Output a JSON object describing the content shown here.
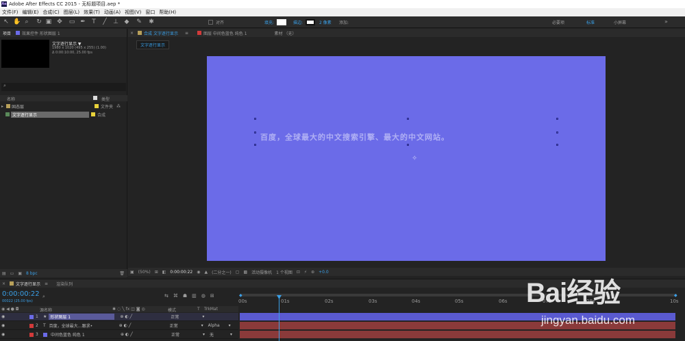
{
  "app": {
    "title": "Adobe After Effects CC 2015 - 无标题项目.aep *",
    "logo": "Ae"
  },
  "menu": [
    "文件(F)",
    "编辑(E)",
    "合成(C)",
    "图层(L)",
    "效果(T)",
    "动画(A)",
    "视图(V)",
    "窗口",
    "帮助(H)"
  ],
  "toolbar": {
    "align_label": "对齐",
    "fill_label": "填充:",
    "stroke_label": "描边:",
    "stroke_width": "2 像素",
    "add_label": "添加:",
    "workspaces": [
      "必要项",
      "标准",
      "小屏幕"
    ]
  },
  "project": {
    "tab": "项目",
    "effects_tab": "效果控件 形状图层 1",
    "comp_name": "文字逐行显示 ▼",
    "comp_size": "1980 x 1020 (495 x 255) (1.00)",
    "comp_duration": "Δ 0:00:10:00, 25.00 fps",
    "col_name": "名称",
    "col_type": "类型",
    "items": [
      {
        "name": "固态层",
        "type": "文件夹",
        "color": "#e8d23a"
      },
      {
        "name": "文字逐行显示",
        "type": "合成",
        "color": "#e8d23a"
      }
    ],
    "bpc": "8 bpc"
  },
  "viewer": {
    "tab_comp": "合成 文字逐行显示",
    "tab_layer": "图层 中间色蓝色 纯色 1",
    "tab_footage": "素材 （无）",
    "breadcrumb": "文字逐行显示",
    "canvas_text": "百度，全球最大的中文搜索引擎、最大的中文网站。",
    "bg": "#6b6be8",
    "zoom": "(50%)",
    "time": "0:00:00:22",
    "resolution": "(二分之一)",
    "camera": "活动摄像机",
    "views": "1 个视图",
    "exposure": "+0.0"
  },
  "timeline": {
    "tab": "文字逐行显示",
    "queue_tab": "渲染队列",
    "timecode": "0:00:00:22",
    "fps": "00022 (25.00 fps)",
    "col_source": "源名称",
    "col_mode": "模式",
    "col_t": "T",
    "col_trkmat": "TrkMat",
    "ticks": [
      "00s",
      "01s",
      "02s",
      "03s",
      "04s",
      "05s",
      "06s",
      "07s",
      "08s",
      "10s"
    ],
    "layers": [
      {
        "num": "1",
        "name": "形状图层 1",
        "mode": "正常",
        "trk": "",
        "color": "#6b6be8",
        "bar": "#5a5ad0"
      },
      {
        "num": "2",
        "name": "百度，全球最大…跟求•",
        "mode": "正常",
        "trk": "Alpha",
        "color": "#d23a3a",
        "bar": "#8a3a3a"
      },
      {
        "num": "3",
        "name": "中间色蓝色 纯色 1",
        "mode": "正常",
        "trk": "无",
        "color": "#d23a3a",
        "bar": "#8a3a3a"
      }
    ]
  },
  "watermark": {
    "brand": "Bai经验",
    "url": "jingyan.baidu.com"
  }
}
